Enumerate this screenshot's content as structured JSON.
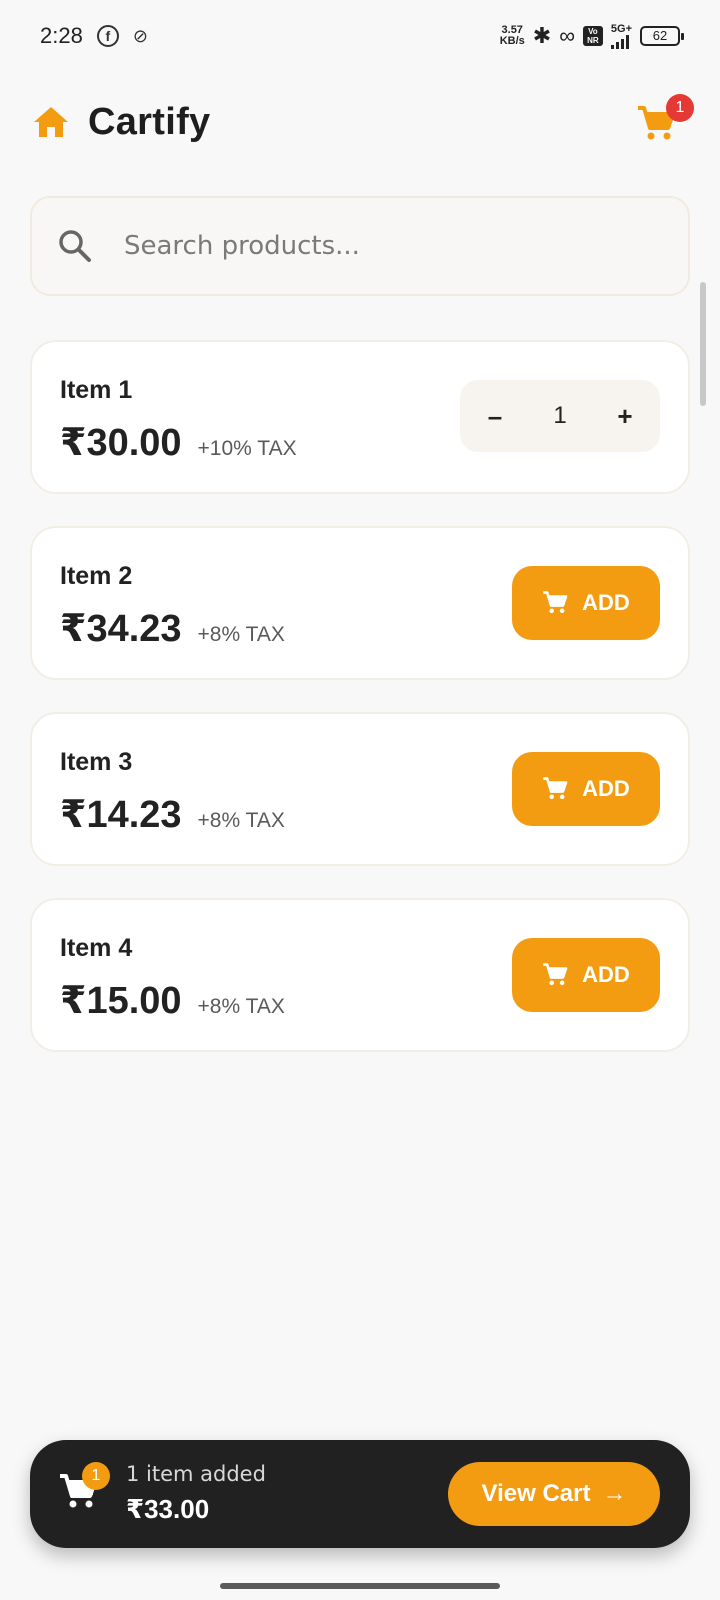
{
  "status_bar": {
    "time": "2:28",
    "speed_top": "3.57",
    "speed_bottom": "KB/s",
    "network_label": "5G+",
    "vonr_top": "Vo",
    "vonr_bottom": "NR",
    "battery": "62"
  },
  "header": {
    "title": "Cartify",
    "home_icon": "home-icon",
    "cart_icon": "cart-icon",
    "cart_badge": "1"
  },
  "search": {
    "placeholder": "Search products...",
    "value": ""
  },
  "products": [
    {
      "name": "Item 1",
      "price": "₹30.00",
      "tax": "+10% TAX",
      "in_cart": true,
      "quantity": "1",
      "minus": "–",
      "plus": "+"
    },
    {
      "name": "Item 2",
      "price": "₹34.23",
      "tax": "+8% TAX",
      "in_cart": false,
      "add_label": "ADD"
    },
    {
      "name": "Item 3",
      "price": "₹14.23",
      "tax": "+8% TAX",
      "in_cart": false,
      "add_label": "ADD"
    },
    {
      "name": "Item 4",
      "price": "₹15.00",
      "tax": "+8% TAX",
      "in_cart": false,
      "add_label": "ADD"
    }
  ],
  "cart_bar": {
    "badge": "1",
    "items_text": "1 item added",
    "total": "₹33.00",
    "view_cart_label": "View Cart",
    "arrow": "→"
  },
  "colors": {
    "accent": "#f39c12",
    "badge_red": "#e53935",
    "dark_bar": "#212121",
    "background": "#f8f8f8"
  }
}
